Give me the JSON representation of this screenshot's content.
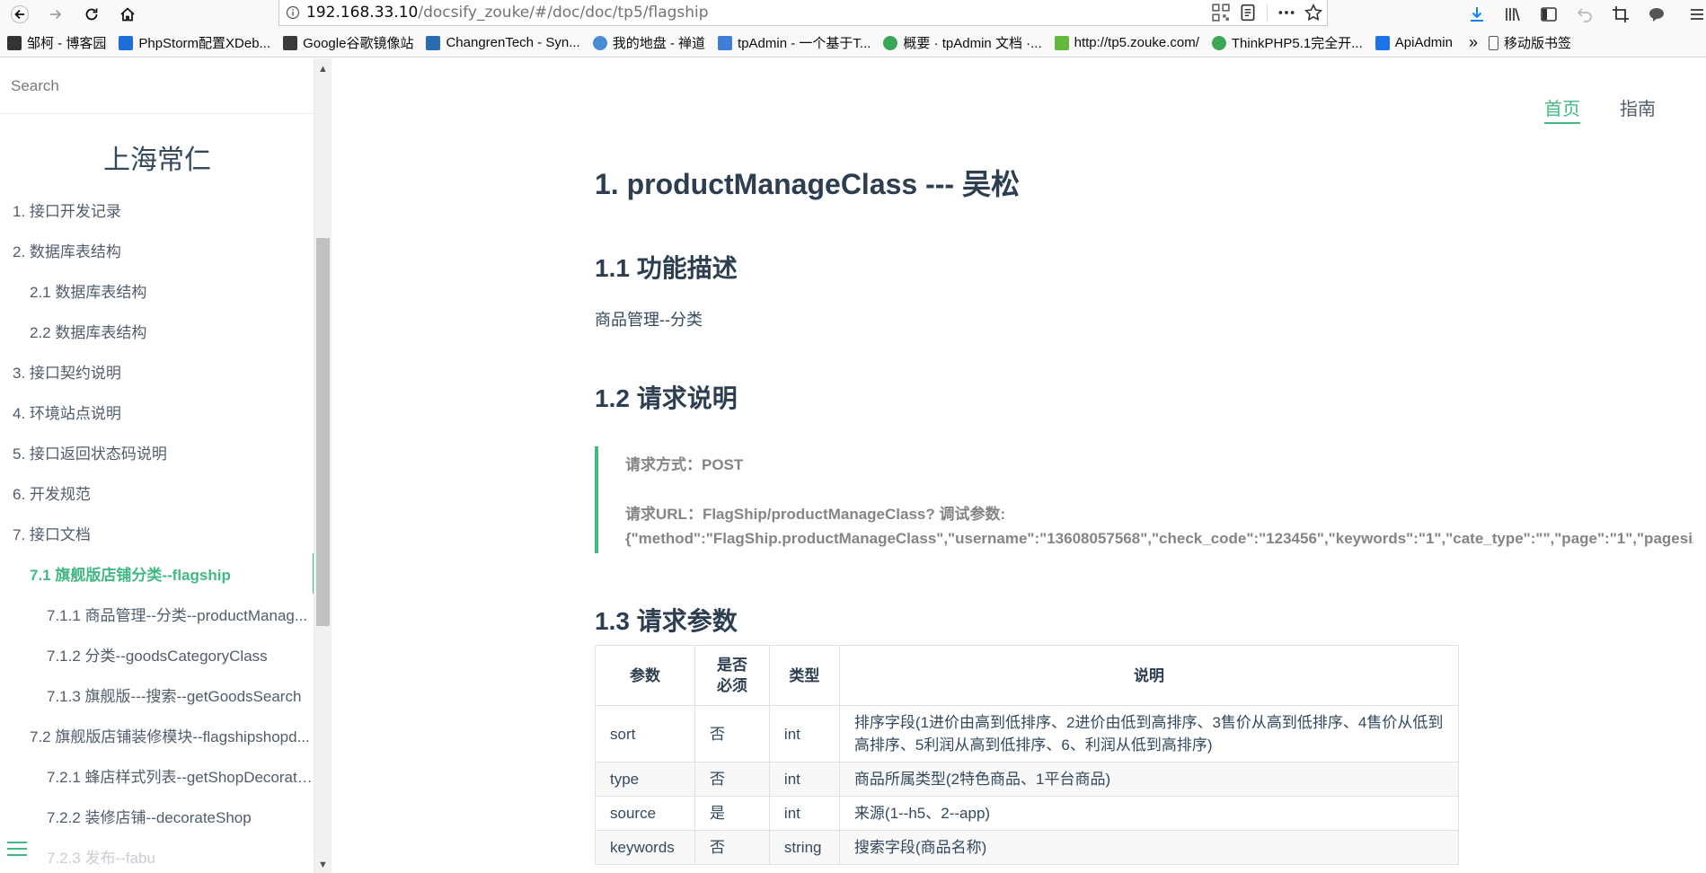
{
  "browser": {
    "url_host": "192.168.33.10",
    "url_path": "/docsify_zouke/#/doc/doc/tp5/flagship",
    "bookmarks": [
      {
        "label": "邹柯 - 博客园",
        "color": "#333333"
      },
      {
        "label": "PhpStorm配置XDeb...",
        "color": "#1e6fd9"
      },
      {
        "label": "Google谷歌镜像站",
        "color": "#3a3a3a"
      },
      {
        "label": "ChangrenTech - Syn...",
        "color": "#2b6cb0"
      },
      {
        "label": "我的地盘 - 禅道",
        "color": "#4a8bd6"
      },
      {
        "label": "tpAdmin - 一个基于T...",
        "color": "#3f7fd9"
      },
      {
        "label": "概要 · tpAdmin 文档 ·...",
        "color": "#3aa757"
      },
      {
        "label": "http://tp5.zouke.com/",
        "color": "#63b93d"
      },
      {
        "label": "ThinkPHP5.1完全开...",
        "color": "#3aa757"
      },
      {
        "label": "ApiAdmin",
        "color": "#1a73e8"
      },
      {
        "label": "移动版书签",
        "color": "#555555"
      }
    ],
    "more_label": "»"
  },
  "sidebar": {
    "search_placeholder": "Search",
    "app_name": "上海常仁",
    "items": [
      {
        "label": "1. 接口开发记录"
      },
      {
        "label": "2. 数据库表结构"
      },
      {
        "label": "2.1 数据库表结构"
      },
      {
        "label": "2.2 数据库表结构"
      },
      {
        "label": "3. 接口契约说明"
      },
      {
        "label": "4. 环境站点说明"
      },
      {
        "label": "5. 接口返回状态码说明"
      },
      {
        "label": "6. 开发规范"
      },
      {
        "label": "7. 接口文档"
      },
      {
        "label": "7.1 旗舰版店铺分类--flagship"
      },
      {
        "label": "7.1.1 商品管理--分类--productManag..."
      },
      {
        "label": "7.1.2 分类--goodsCategoryClass"
      },
      {
        "label": "7.1.3 旗舰版---搜索--getGoodsSearch"
      },
      {
        "label": "7.2 旗舰版店铺装修模块--flagshipshopd..."
      },
      {
        "label": "7.2.1 蜂店样式列表--getShopDecorate..."
      },
      {
        "label": "7.2.2 装修店铺--decorateShop"
      },
      {
        "label": "7.2.3 发布--fabu"
      }
    ]
  },
  "topnav": {
    "home": "首页",
    "guide": "指南"
  },
  "doc": {
    "title": "1. productManageClass --- 吴松",
    "h_func": "1.1 功能描述",
    "func_desc": "商品管理--分类",
    "h_req": "1.2 请求说明",
    "req_method": "请求方式：POST",
    "req_url": "请求URL：FlagShip/productManageClass? 调试参数:",
    "req_params": "{\"method\":\"FlagShip.productManageClass\",\"username\":\"13608057568\",\"check_code\":\"123456\",\"keywords\":\"1\",\"cate_type\":\"\",\"page\":\"1\",\"pagesize\"",
    "h_params": "1.3 请求参数",
    "table": {
      "headers": [
        "参数",
        "是否\n必须",
        "类型",
        "说明"
      ],
      "rows": [
        [
          "sort",
          "否",
          "int",
          "排序字段(1进价由高到低排序、2进价由低到高排序、3售价从高到低排序、4售价从低到高排序、5利润从高到低排序、6、利润从低到高排序)"
        ],
        [
          "type",
          "否",
          "int",
          "商品所属类型(2特色商品、1平台商品)"
        ],
        [
          "source",
          "是",
          "int",
          "来源(1--h5、2--app)"
        ],
        [
          "keywords",
          "否",
          "string",
          "搜索字段(商品名称)"
        ]
      ]
    }
  }
}
